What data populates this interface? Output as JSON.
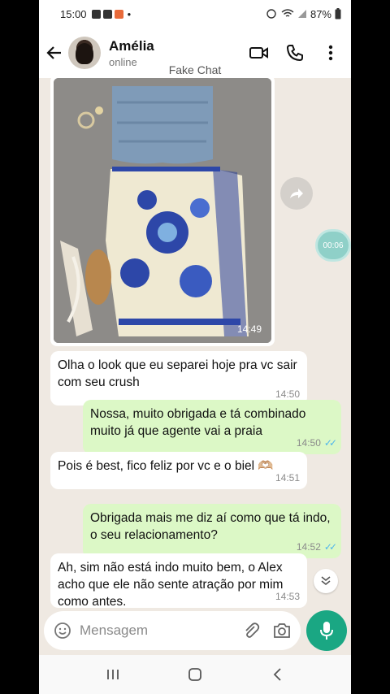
{
  "status": {
    "time": "15:00",
    "battery": "87%"
  },
  "header": {
    "contact_name": "Amélia",
    "presence": "online"
  },
  "watermark": "Fake Chat",
  "image_message": {
    "time": "14:49"
  },
  "recording_badge": "00:06",
  "messages": [
    {
      "direction": "in",
      "text": "Olha o look que eu separei hoje pra vc sair com seu crush",
      "time": "14:50"
    },
    {
      "direction": "out",
      "text": "Nossa, muito obrigada e tá combinado muito já que agente vai a praia",
      "time": "14:50"
    },
    {
      "direction": "in",
      "text": "Pois é best, fico feliz por vc e o biel 🫶🏼",
      "time": "14:51"
    },
    {
      "direction": "out",
      "text": "Obrigada mais me diz aí como que tá indo, o seu relacionamento?",
      "time": "14:52"
    },
    {
      "direction": "in",
      "text": "Ah, sim não está indo muito bem, o Alex acho que ele não sente atração por mim como antes.",
      "time": "14:53"
    }
  ],
  "composer": {
    "placeholder": "Mensagem"
  },
  "colors": {
    "outgoing_bubble": "#dcf8c6",
    "incoming_bubble": "#ffffff",
    "accent": "#1aa783",
    "read_ticks": "#4fb6ec"
  }
}
